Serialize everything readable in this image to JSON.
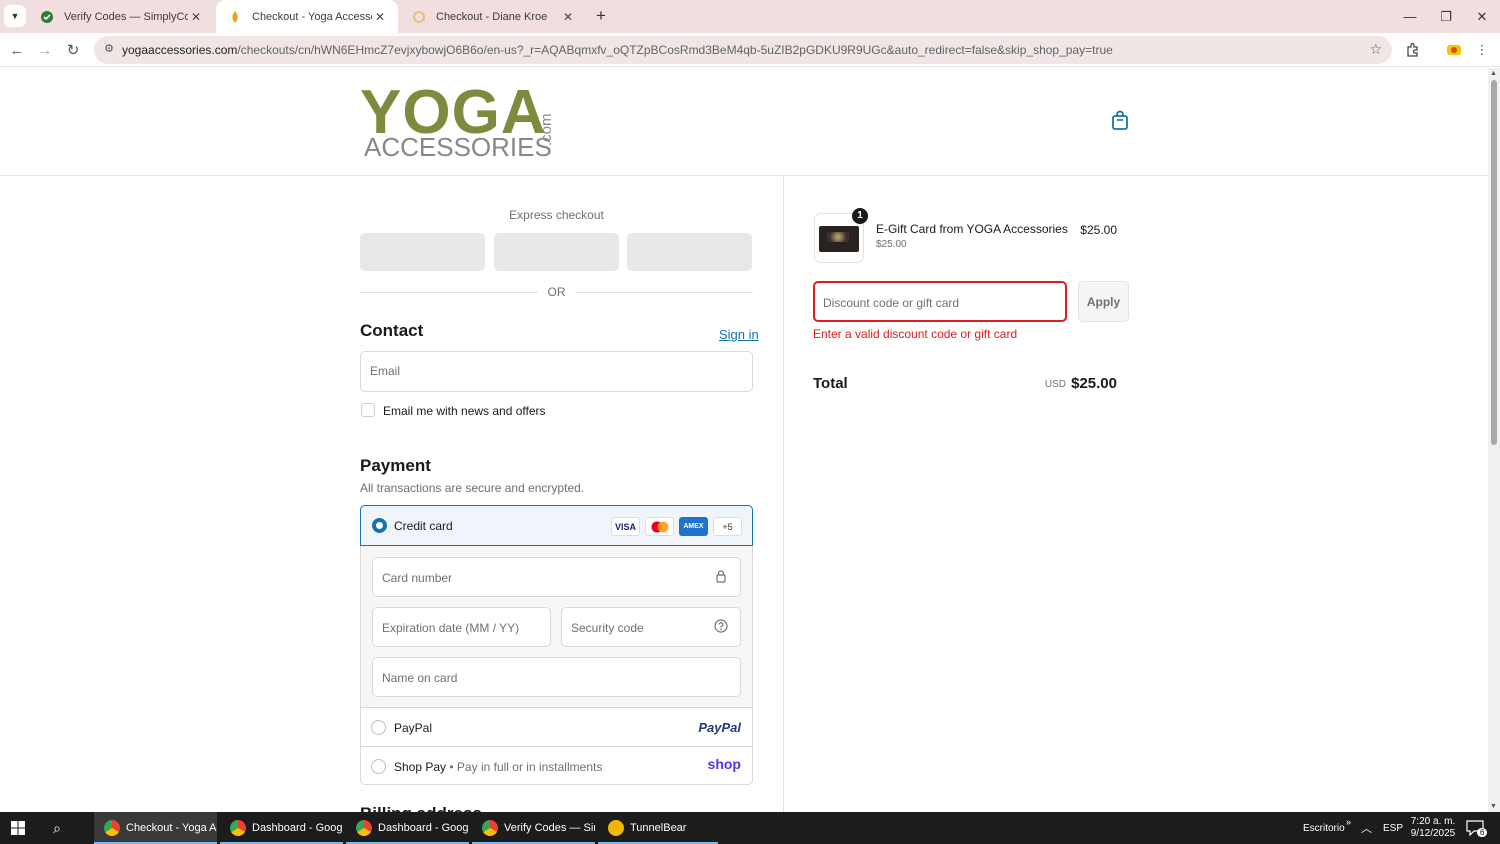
{
  "browser": {
    "tabs": [
      {
        "title": "Verify Codes — SimplyCodes",
        "icon": "simplycodes-icon"
      },
      {
        "title": "Checkout - Yoga Accessories",
        "icon": "yoga-icon"
      },
      {
        "title": "Checkout - Diane Kroe",
        "icon": "loading-icon"
      }
    ],
    "url_host": "yogaaccessories.com",
    "url_path": "/checkouts/cn/hWN6EHmcZ7evjxybowjO6B6o/en-us?_r=AQABqmxfv_oQTZpBCosRmd3BeM4qb-5uZIB2pGDKU9R9UGc&auto_redirect=false&skip_shop_pay=true"
  },
  "logo": {
    "line1": "YOGA",
    "line2": "ACCESSORIES",
    "suffix": ".com"
  },
  "express": {
    "label": "Express checkout",
    "or": "OR"
  },
  "contact": {
    "heading": "Contact",
    "signin": "Sign in",
    "email_placeholder": "Email",
    "newsletter_label": "Email me with news and offers"
  },
  "payment": {
    "heading": "Payment",
    "subtitle": "All transactions are secure and encrypted.",
    "credit_card_label": "Credit card",
    "card_brands": [
      "VISA",
      "MC",
      "AMEX",
      "+5"
    ],
    "card_number_placeholder": "Card number",
    "expiry_placeholder": "Expiration date (MM / YY)",
    "security_placeholder": "Security code",
    "name_placeholder": "Name on card",
    "paypal_label": "PayPal",
    "paypal_logo": "PayPal",
    "shoppay_label": "Shop Pay",
    "shoppay_sub": "• Pay in full or in installments",
    "shop_logo": "shop",
    "next_heading": "Billing address"
  },
  "summary": {
    "item_name": "E-Gift Card from YOGA Accessories",
    "item_sub": "$25.00",
    "item_price": "$25.00",
    "quantity": "1",
    "discount_placeholder": "Discount code or gift card",
    "apply": "Apply",
    "error": "Enter a valid discount code or gift card",
    "total_label": "Total",
    "currency": "USD",
    "total": "$25.00"
  },
  "taskbar": {
    "apps": [
      {
        "label": "Checkout - Yoga A..."
      },
      {
        "label": "Dashboard - Googl..."
      },
      {
        "label": "Dashboard - Googl..."
      },
      {
        "label": "Verify Codes — Sim..."
      },
      {
        "label": "TunnelBear"
      }
    ],
    "desktop": "Escritorio",
    "lang": "ESP",
    "time": "7:20 a. m.",
    "date": "9/12/2025",
    "notifications": "6"
  },
  "colors": {
    "accent": "#1773b0",
    "error": "#dd1d1d",
    "brand_green": "#7e8a3e"
  }
}
